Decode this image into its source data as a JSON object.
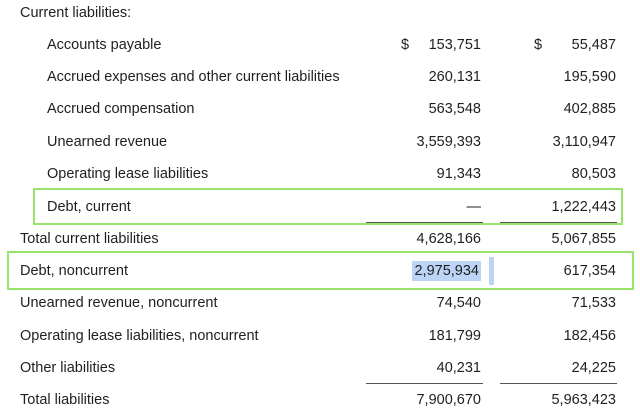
{
  "section_title": "Current liabilities:",
  "currency_symbol": "$",
  "rows": [
    {
      "label": "Accounts payable",
      "col1": "153,751",
      "col2": "55,487"
    },
    {
      "label": "Accrued expenses and other current liabilities",
      "col1": "260,131",
      "col2": "195,590"
    },
    {
      "label": "Accrued compensation",
      "col1": "563,548",
      "col2": "402,885"
    },
    {
      "label": "Unearned revenue",
      "col1": "3,559,393",
      "col2": "3,110,947"
    },
    {
      "label": "Operating lease liabilities",
      "col1": "91,343",
      "col2": "80,503"
    },
    {
      "label": "Debt, current",
      "col1": "—",
      "col2": "1,222,443"
    },
    {
      "label": "Total current liabilities",
      "col1": "4,628,166",
      "col2": "5,067,855"
    },
    {
      "label": "Debt, noncurrent",
      "col1": "2,975,934",
      "col2": "617,354"
    },
    {
      "label": "Unearned revenue, noncurrent",
      "col1": "74,540",
      "col2": "71,533"
    },
    {
      "label": "Operating lease liabilities, noncurrent",
      "col1": "181,799",
      "col2": "182,456"
    },
    {
      "label": "Other liabilities",
      "col1": "40,231",
      "col2": "24,225"
    },
    {
      "label": "Total liabilities",
      "col1": "7,900,670",
      "col2": "5,963,423"
    }
  ],
  "colors": {
    "highlight_border": "#98e46b",
    "selection": "#bcd4f5"
  }
}
